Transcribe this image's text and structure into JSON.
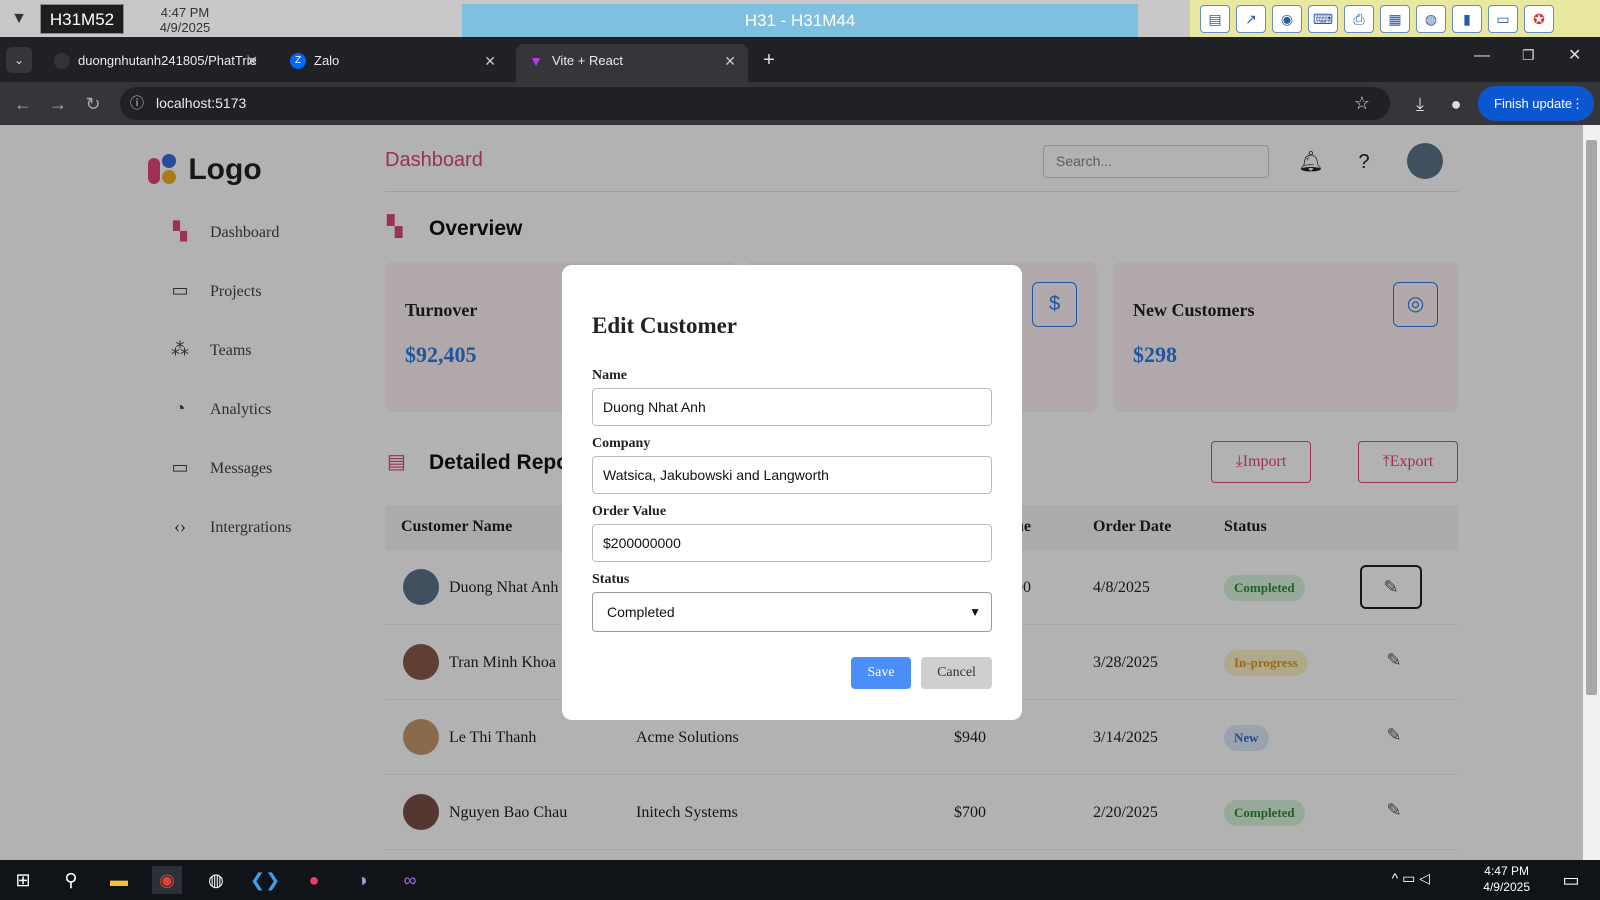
{
  "system_bar": {
    "machine": "H31M52",
    "time": "4:47 PM",
    "date": "4/9/2025",
    "session": "H31 - H31M44"
  },
  "browser": {
    "tabs": [
      {
        "label": "duongnhutanh241805/PhatTrie",
        "icon": "github-icon"
      },
      {
        "label": "Zalo",
        "icon": "zalo-icon"
      },
      {
        "label": "Vite + React",
        "icon": "vite-icon"
      }
    ],
    "url": "localhost:5173",
    "finish_update": "Finish update"
  },
  "app": {
    "logo_text": "Logo",
    "nav": [
      {
        "label": "Dashboard",
        "icon": "grid-icon"
      },
      {
        "label": "Projects",
        "icon": "folder-icon"
      },
      {
        "label": "Teams",
        "icon": "teams-icon"
      },
      {
        "label": "Analytics",
        "icon": "pie-chart-icon"
      },
      {
        "label": "Messages",
        "icon": "message-icon"
      },
      {
        "label": "Intergrations",
        "icon": "code-icon"
      }
    ],
    "page_title": "Dashboard",
    "search_placeholder": "Search...",
    "overview_title": "Overview",
    "cards": [
      {
        "label": "Turnover",
        "value": "$92,405",
        "icon": "dollar-icon"
      },
      {
        "label": "New Customers",
        "value": "$298",
        "icon": "user-circle-icon"
      }
    ],
    "report_title": "Detailed Repo",
    "import_label": "Import",
    "export_label": "Export",
    "table": {
      "headers": [
        "Customer Name",
        "ue",
        "Order Date",
        "Status"
      ],
      "rows": [
        {
          "name": "Duong Nhat Anh",
          "company": "",
          "value": "00",
          "date": "4/8/2025",
          "status": "Completed"
        },
        {
          "name": "Tran Minh Khoa",
          "company": "",
          "value": "",
          "date": "3/28/2025",
          "status": "In-progress"
        },
        {
          "name": "Le Thi Thanh",
          "company": "Acme Solutions",
          "value": "$940",
          "date": "3/14/2025",
          "status": "New"
        },
        {
          "name": "Nguyen Bao Chau",
          "company": "Initech Systems",
          "value": "$700",
          "date": "2/20/2025",
          "status": "Completed"
        }
      ]
    }
  },
  "modal": {
    "title": "Edit Customer",
    "name_label": "Name",
    "name_value": "Duong Nhat Anh",
    "company_label": "Company",
    "company_value": "Watsica, Jakubowski and Langworth",
    "order_label": "Order Value",
    "order_value": "$200000000",
    "status_label": "Status",
    "status_value": "Completed",
    "save_label": "Save",
    "cancel_label": "Cancel"
  },
  "taskbar": {
    "time": "4:47 PM",
    "date": "4/9/2025"
  },
  "colors": {
    "accent": "#e0457b",
    "primary_blue": "#2b7be4",
    "save_button": "#4b8ef7",
    "badge_completed_bg": "#d9f2dc",
    "badge_completed_text": "#2e8b3a",
    "badge_progress_bg": "#fdf1c6",
    "badge_progress_text": "#d99a12",
    "badge_new_bg": "#dbe9fb",
    "badge_new_text": "#3a6fc0"
  }
}
